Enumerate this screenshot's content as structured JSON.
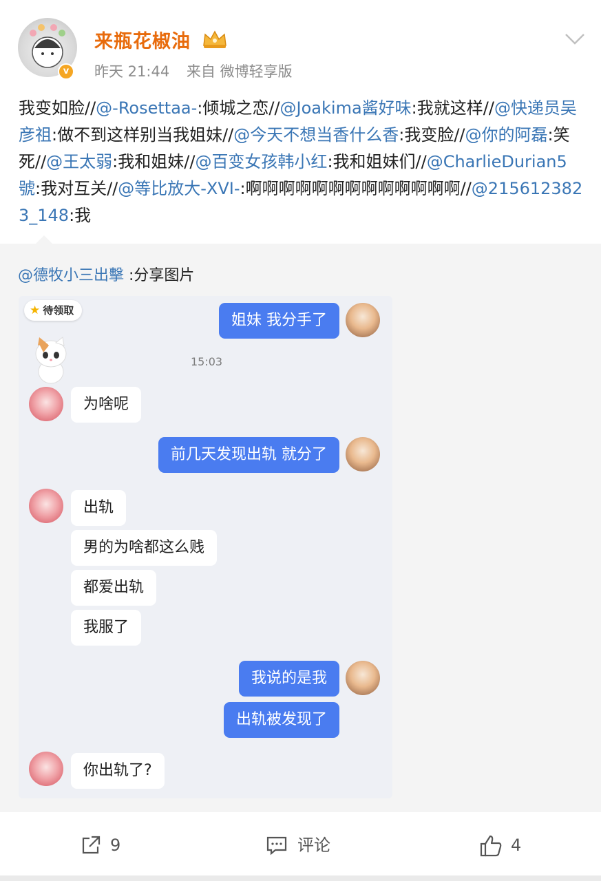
{
  "author": {
    "name": "来瓶花椒油",
    "time": "昨天 21:44",
    "source": "来自 微博轻享版",
    "verified_color": "#f5a623",
    "name_color": "#e86b0c"
  },
  "post_text": [
    {
      "t": "text",
      "v": "我变如脸//"
    },
    {
      "t": "mention",
      "v": "@-Rosettaa-"
    },
    {
      "t": "text",
      "v": ":倾城之恋//"
    },
    {
      "t": "mention",
      "v": "@Joakima酱好味"
    },
    {
      "t": "text",
      "v": ":我就这样//"
    },
    {
      "t": "mention",
      "v": "@快递员吴彦祖"
    },
    {
      "t": "text",
      "v": ":做不到这样别当我姐妹//"
    },
    {
      "t": "mention",
      "v": "@今天不想当香什么香"
    },
    {
      "t": "text",
      "v": ":我变脸//"
    },
    {
      "t": "mention",
      "v": "@你的阿磊"
    },
    {
      "t": "text",
      "v": ":笑死//"
    },
    {
      "t": "mention",
      "v": "@王太弱"
    },
    {
      "t": "text",
      "v": ":我和姐妹//"
    },
    {
      "t": "mention",
      "v": "@百变女孩韩小红"
    },
    {
      "t": "text",
      "v": ":我和姐妹们//"
    },
    {
      "t": "mention",
      "v": "@CharlieDurian5號"
    },
    {
      "t": "text",
      "v": ":我对互关//"
    },
    {
      "t": "mention",
      "v": "@等比放大-XVI-"
    },
    {
      "t": "text",
      "v": ":啊啊啊啊啊啊啊啊啊啊啊啊啊//"
    },
    {
      "t": "mention",
      "v": "@2156123823_148"
    },
    {
      "t": "text",
      "v": ":我"
    }
  ],
  "repost": {
    "mention": "@德牧小三出擊",
    "text": " :分享图片"
  },
  "chat": {
    "pending_badge": "待领取",
    "time": "15:03",
    "messages": [
      {
        "side": "out",
        "text": "姐妹 我分手了"
      },
      {
        "side": "in",
        "text": "为啥呢"
      },
      {
        "side": "out",
        "text": "前几天发现出轨 就分了"
      },
      {
        "side": "in",
        "text": "出轨"
      },
      {
        "side": "in",
        "text": "男的为啥都这么贱"
      },
      {
        "side": "in",
        "text": "都爱出轨"
      },
      {
        "side": "in",
        "text": "我服了"
      },
      {
        "side": "out",
        "text": "我说的是我"
      },
      {
        "side": "out",
        "text": "出轨被发现了"
      },
      {
        "side": "in",
        "text": "你出轨了?"
      }
    ]
  },
  "footer": {
    "share_count": "9",
    "comment_label": "评论",
    "like_count": "4"
  },
  "colors": {
    "mention": "#3a76b5",
    "bubble_out": "#4a7cf0",
    "bubble_in": "#ffffff"
  }
}
